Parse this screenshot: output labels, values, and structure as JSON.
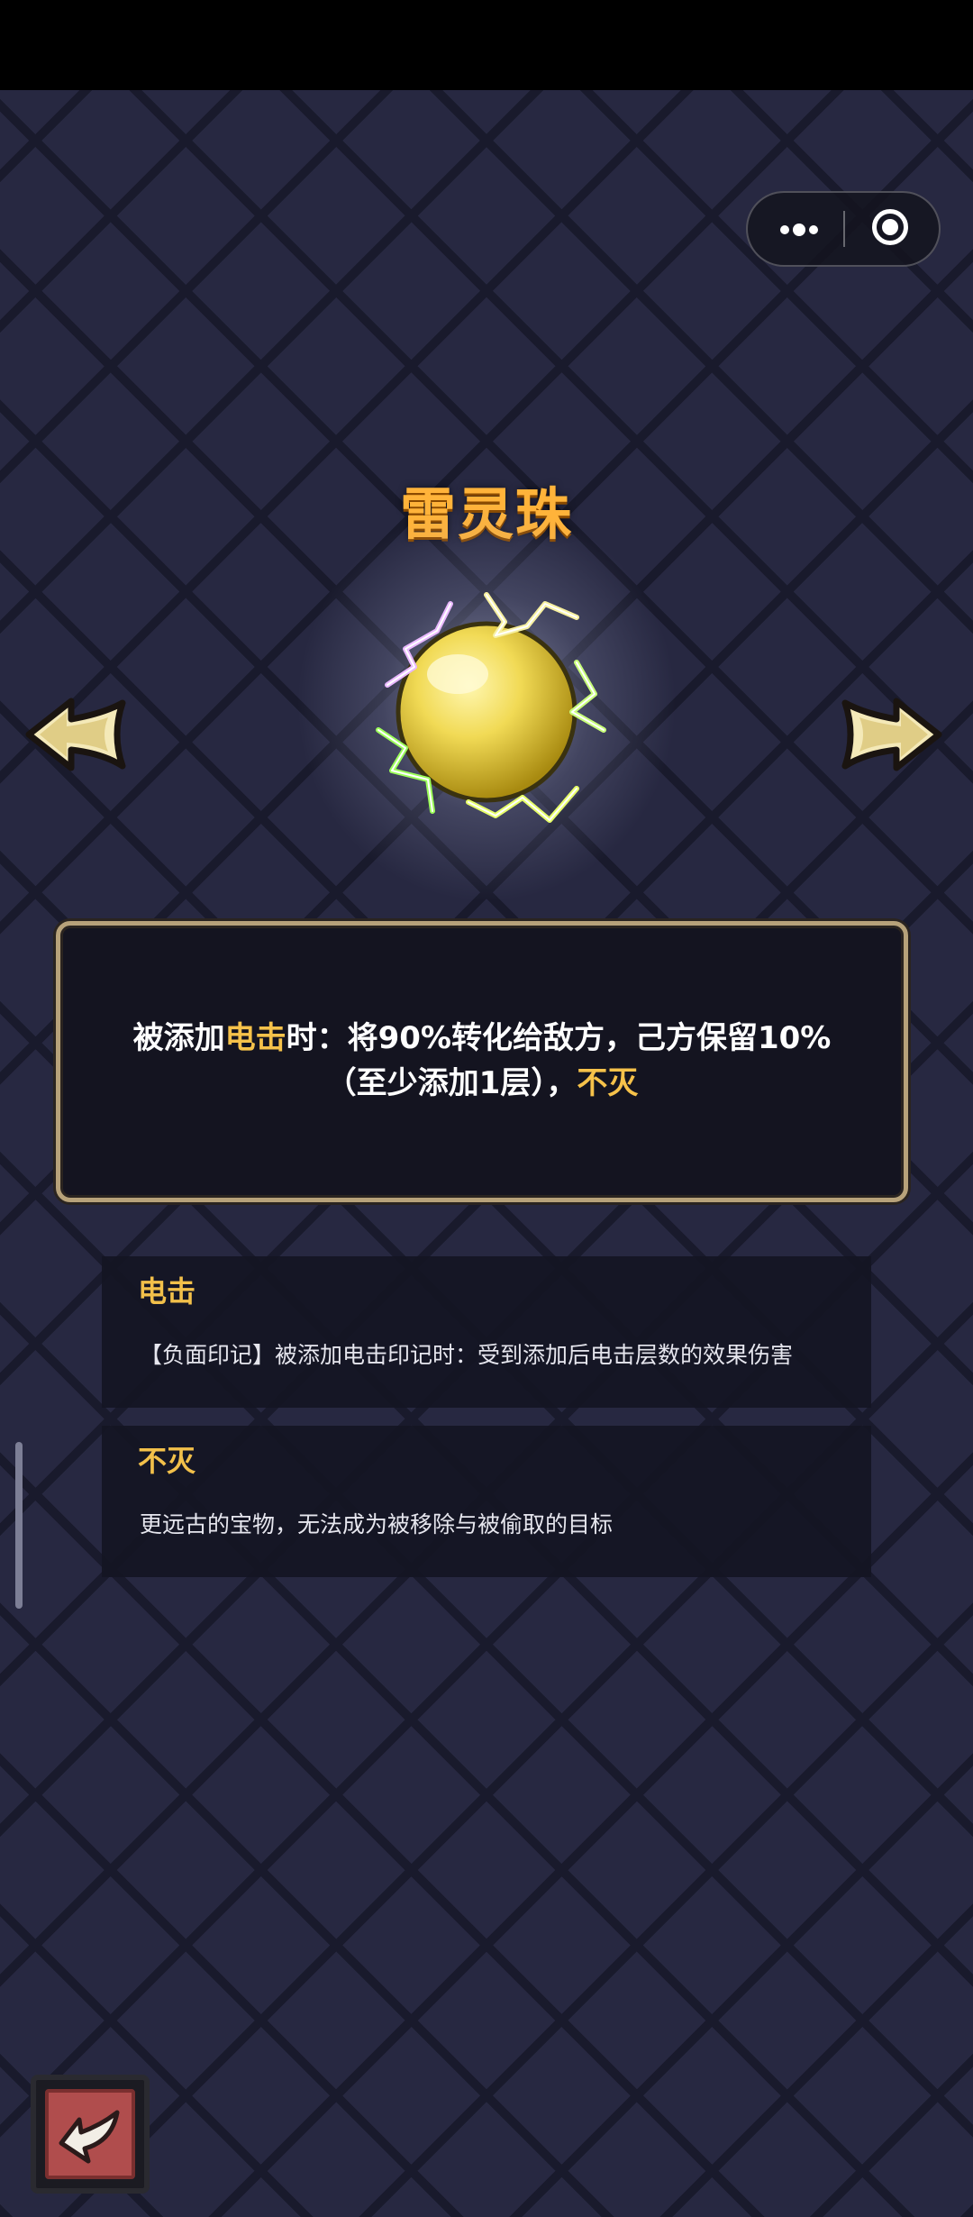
{
  "item": {
    "name": "雷灵珠",
    "description_parts": [
      "被添加",
      "电击",
      "时：将90%转化给敌方，己方保留10%",
      "（至少添加1层），",
      "不灭"
    ]
  },
  "keywords": [
    {
      "title": "电击",
      "body": "【负面印记】被添加电击印记时：受到添加后电击层数的效果伤害"
    },
    {
      "title": "不灭",
      "body": "更远古的宝物，无法成为被移除与被偷取的目标"
    }
  ],
  "colors": {
    "title": "#ffb33a",
    "highlight": "#f6c24a",
    "keyword_title": "#f2c04a",
    "frame_border": "#b7a27a",
    "back_button": "#b04d4d"
  },
  "icons": {
    "capsule_more": "more-dots-icon",
    "capsule_close": "target-close-icon",
    "nav_prev": "arrow-left-icon",
    "nav_next": "arrow-right-icon",
    "orb": "thunder-orb-icon",
    "back": "return-arrow-icon"
  }
}
